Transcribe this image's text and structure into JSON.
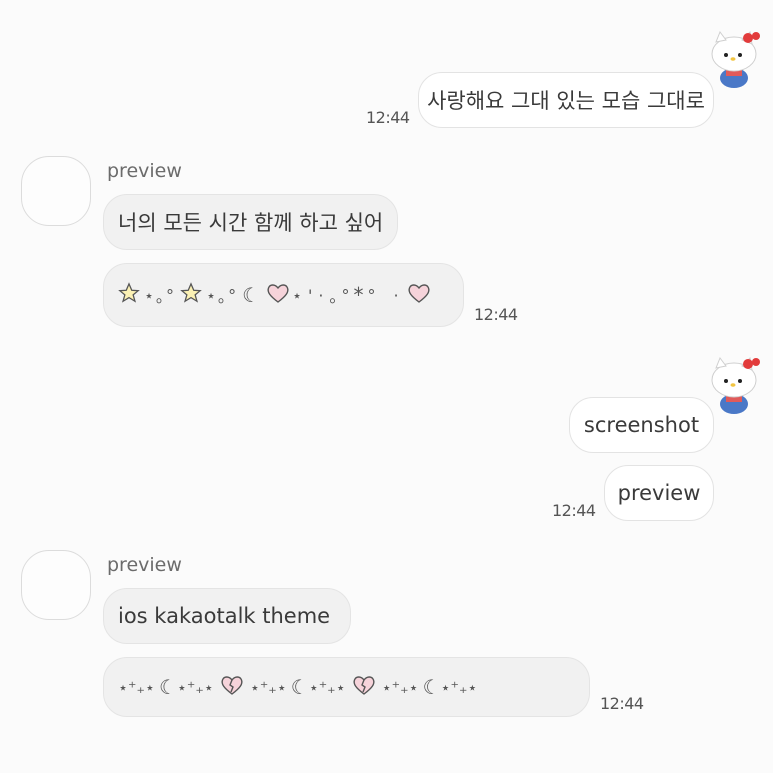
{
  "chat": {
    "msg1": {
      "text": "사랑해요 그대 있는 모습 그대로",
      "time": "12:44"
    },
    "group1": {
      "sender": "preview",
      "msg_text": "너의 모든 시간 함께 하고 싶어",
      "decor": [
        "☆",
        "⋆",
        "｡",
        "°",
        "☆",
        "⋆",
        "｡",
        "°",
        "☾",
        "♡",
        "⋆",
        "'",
        "·",
        "｡",
        "°",
        "*",
        "°",
        "·",
        "♡"
      ],
      "time": "12:44"
    },
    "msg3": {
      "text": "screenshot"
    },
    "msg4": {
      "text": "preview",
      "time": "12:44"
    },
    "group2": {
      "sender": "preview",
      "msg_text": "ios kakaotalk theme",
      "decor": [
        "⋆⁺",
        "₊",
        "⋆",
        "☾",
        "⋆",
        "⁺",
        "₊",
        "⋆",
        "♡",
        "⋆⁺",
        "₊",
        "⋆",
        "☾",
        "⋆",
        "⁺",
        "₊",
        "⋆",
        "♡",
        "⋆⁺",
        "₊",
        "⋆",
        "☾",
        "⋆",
        "⁺",
        "₊",
        "⋆"
      ],
      "time": "12:44"
    }
  },
  "colors": {
    "background": "#fbfbfb",
    "incoming_bubble": "#f1f1f1",
    "outgoing_bubble": "#ffffff",
    "heart_pink": "#f6d3da",
    "star_yellow": "#fbf1b4"
  },
  "icons": {
    "my_avatar": "hello-kitty-icon",
    "friend_avatar": "blank-avatar-icon"
  }
}
